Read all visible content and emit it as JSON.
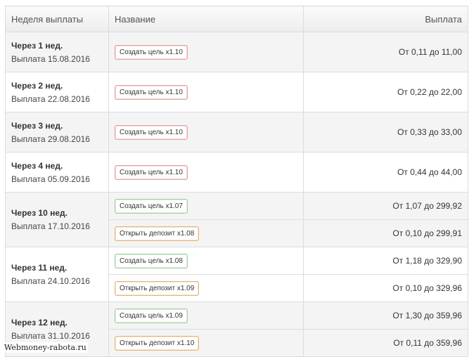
{
  "colors": {
    "tag_red": "#e0a3a3",
    "tag_green": "#9fcf9f",
    "tag_orange": "#e6b47a",
    "header_bg": "#ececec"
  },
  "table": {
    "headers": {
      "week": "Неделя выплаты",
      "name": "Название",
      "payout": "Выплата"
    },
    "rows": [
      {
        "week": "Через 1 нед.",
        "date": "Выплата 15.08.2016",
        "items": [
          {
            "name": "Создать цель x1.10",
            "color": "red",
            "payout": "От 0,11 до 11,00"
          }
        ]
      },
      {
        "week": "Через 2 нед.",
        "date": "Выплата 22.08.2016",
        "items": [
          {
            "name": "Создать цель x1.10",
            "color": "red",
            "payout": "От 0,22 до 22,00"
          }
        ]
      },
      {
        "week": "Через 3 нед.",
        "date": "Выплата 29.08.2016",
        "items": [
          {
            "name": "Создать цель x1.10",
            "color": "red",
            "payout": "От 0,33 до 33,00"
          }
        ]
      },
      {
        "week": "Через 4 нед.",
        "date": "Выплата 05.09.2016",
        "items": [
          {
            "name": "Создать цель x1.10",
            "color": "red",
            "payout": "От 0,44 до 44,00"
          }
        ]
      },
      {
        "week": "Через 10 нед.",
        "date": "Выплата 17.10.2016",
        "items": [
          {
            "name": "Создать цель x1.07",
            "color": "green",
            "payout": "От 1,07 до 299,92"
          },
          {
            "name": "Открыть депозит x1.08",
            "color": "orange",
            "payout": "От 0,10 до 299,91"
          }
        ]
      },
      {
        "week": "Через 11 нед.",
        "date": "Выплата 24.10.2016",
        "items": [
          {
            "name": "Создать цель x1.08",
            "color": "green",
            "payout": "От 1,18 до 329,90"
          },
          {
            "name": "Открыть депозит x1.09",
            "color": "orange",
            "payout": "От 0,10 до 329,96"
          }
        ]
      },
      {
        "week": "Через 12 нед.",
        "date": "Выплата 31.10.2016",
        "items": [
          {
            "name": "Создать цель x1.09",
            "color": "green",
            "payout": "От 1,30 до 359,96"
          },
          {
            "name": "Открыть депозит x1.10",
            "color": "orange",
            "payout": "От 0,11 до 359,96"
          }
        ]
      }
    ]
  },
  "watermark": "Webmoney-rabota.ru"
}
